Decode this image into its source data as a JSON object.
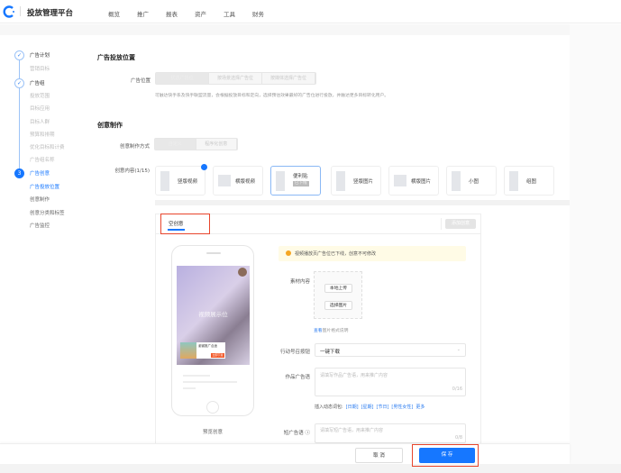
{
  "app": {
    "title": "投放管理平台"
  },
  "nav": [
    "概览",
    "推广",
    "报表",
    "资产",
    "工具",
    "财务"
  ],
  "sidebar": [
    {
      "label": "广告计划",
      "type": "step",
      "state": "done"
    },
    {
      "label": "营销目标",
      "type": "sub"
    },
    {
      "label": "广告组",
      "type": "step",
      "state": "done"
    },
    {
      "label": "投放范围",
      "type": "sub"
    },
    {
      "label": "目标应用",
      "type": "sub"
    },
    {
      "label": "目标人群",
      "type": "sub"
    },
    {
      "label": "预算和排期",
      "type": "sub"
    },
    {
      "label": "优化目标和计费",
      "type": "sub"
    },
    {
      "label": "广告组名称",
      "type": "sub"
    },
    {
      "label": "广告创意",
      "type": "step",
      "state": "active",
      "num": "3"
    },
    {
      "label": "广告投放位置",
      "type": "sub",
      "state": "active"
    },
    {
      "label": "创意制作",
      "type": "sub"
    },
    {
      "label": "创意分类和标签",
      "type": "sub"
    },
    {
      "label": "广告监控",
      "type": "sub"
    }
  ],
  "placement": {
    "section_title": "广告投放位置",
    "label": "广告位置",
    "options": [
      "优选广告位",
      "按场景选择广告位",
      "按媒体选择广告位"
    ],
    "selected": 0,
    "help": "可触达快手系及快手联盟流量，会根据投放目标和定向，选择预估效果最好的广告位进行投放，并触达更多目标转化用户。"
  },
  "creative": {
    "section_title": "创意制作",
    "mode_label": "创意制作方式",
    "modes": [
      "自定义",
      "程序化创意"
    ],
    "content_label": "创意内容(1/15)",
    "cards": [
      {
        "label": "竖版视频",
        "badge": true
      },
      {
        "label": "横版视频"
      },
      {
        "label": "便利贴",
        "tag": "已下线",
        "selected": true
      },
      {
        "label": "竖版图片"
      },
      {
        "label": "横版图片"
      },
      {
        "label": "小图"
      },
      {
        "label": "组图"
      }
    ]
  },
  "panel": {
    "tab": "空创意",
    "add_button": "添加创意",
    "preview": {
      "video_text": "视频展示位",
      "card_title": "谢谢推广合适",
      "card_btn": "立即下载",
      "preview_label": "预览创意"
    },
    "alert": "视频播放页广告位已下线，创意不可修改",
    "material_label": "素材内容",
    "upload_local": "本地上传",
    "choose_image": "选择图片",
    "format_link": "查看",
    "format_text": "图片格式说明",
    "cta_label": "行动号召按钮",
    "cta_value": "一键下载",
    "slogan_label": "作品广告语",
    "slogan_placeholder": "请填写作品广告语，用来推广内容",
    "slogan_count": "0/16",
    "dyn_label": "插入动态词包:",
    "dyn_words": [
      "[日期]",
      "[星期]",
      "[节日]",
      "[男性女性]",
      "更多"
    ],
    "short_label": "短广告语 ⓘ",
    "short_placeholder": "请填写短广告语，用来推广内容",
    "short_count": "0/8"
  },
  "footer": {
    "cancel": "取 消",
    "save": "保 存"
  },
  "colors": {
    "primary": "#1677ff",
    "highlight": "#e8452c",
    "alert_bg": "#fffbe6"
  }
}
